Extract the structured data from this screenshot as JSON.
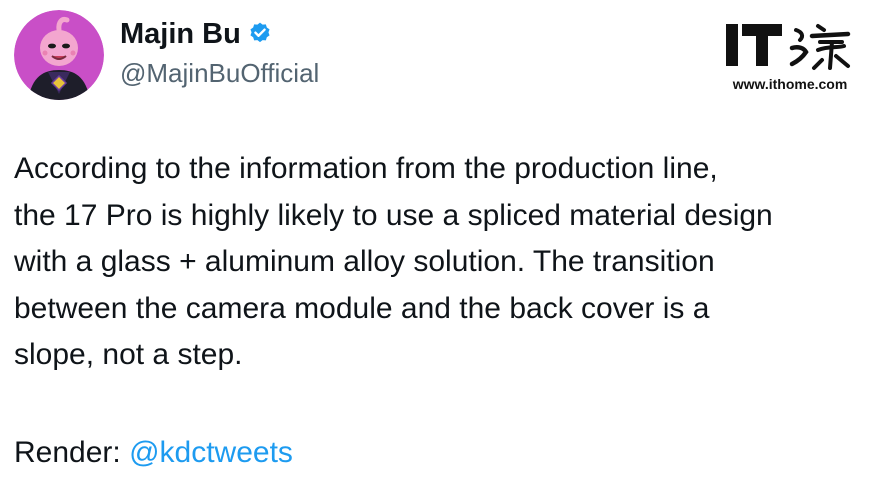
{
  "author": {
    "display_name": "Majin Bu",
    "handle": "@MajinBuOfficial",
    "verified": true
  },
  "watermark": {
    "logo_text": "IT之家",
    "url": "www.ithome.com"
  },
  "tweet": {
    "lines": [
      "According to the information from the production line,",
      "the 17 Pro is highly likely to use a spliced material design",
      "with a glass + aluminum alloy solution. The transition",
      "between the camera module and the back cover is a",
      "slope, not a step."
    ],
    "render_label": "Render:",
    "render_mention": "@kdctweets"
  },
  "colors": {
    "text": "#0f1419",
    "secondary_text": "#536471",
    "link": "#1d9bf0",
    "verified_badge": "#1d9bf0"
  },
  "icons": {
    "verified": "verified-badge-icon",
    "avatar": "majin-buu-avatar"
  }
}
